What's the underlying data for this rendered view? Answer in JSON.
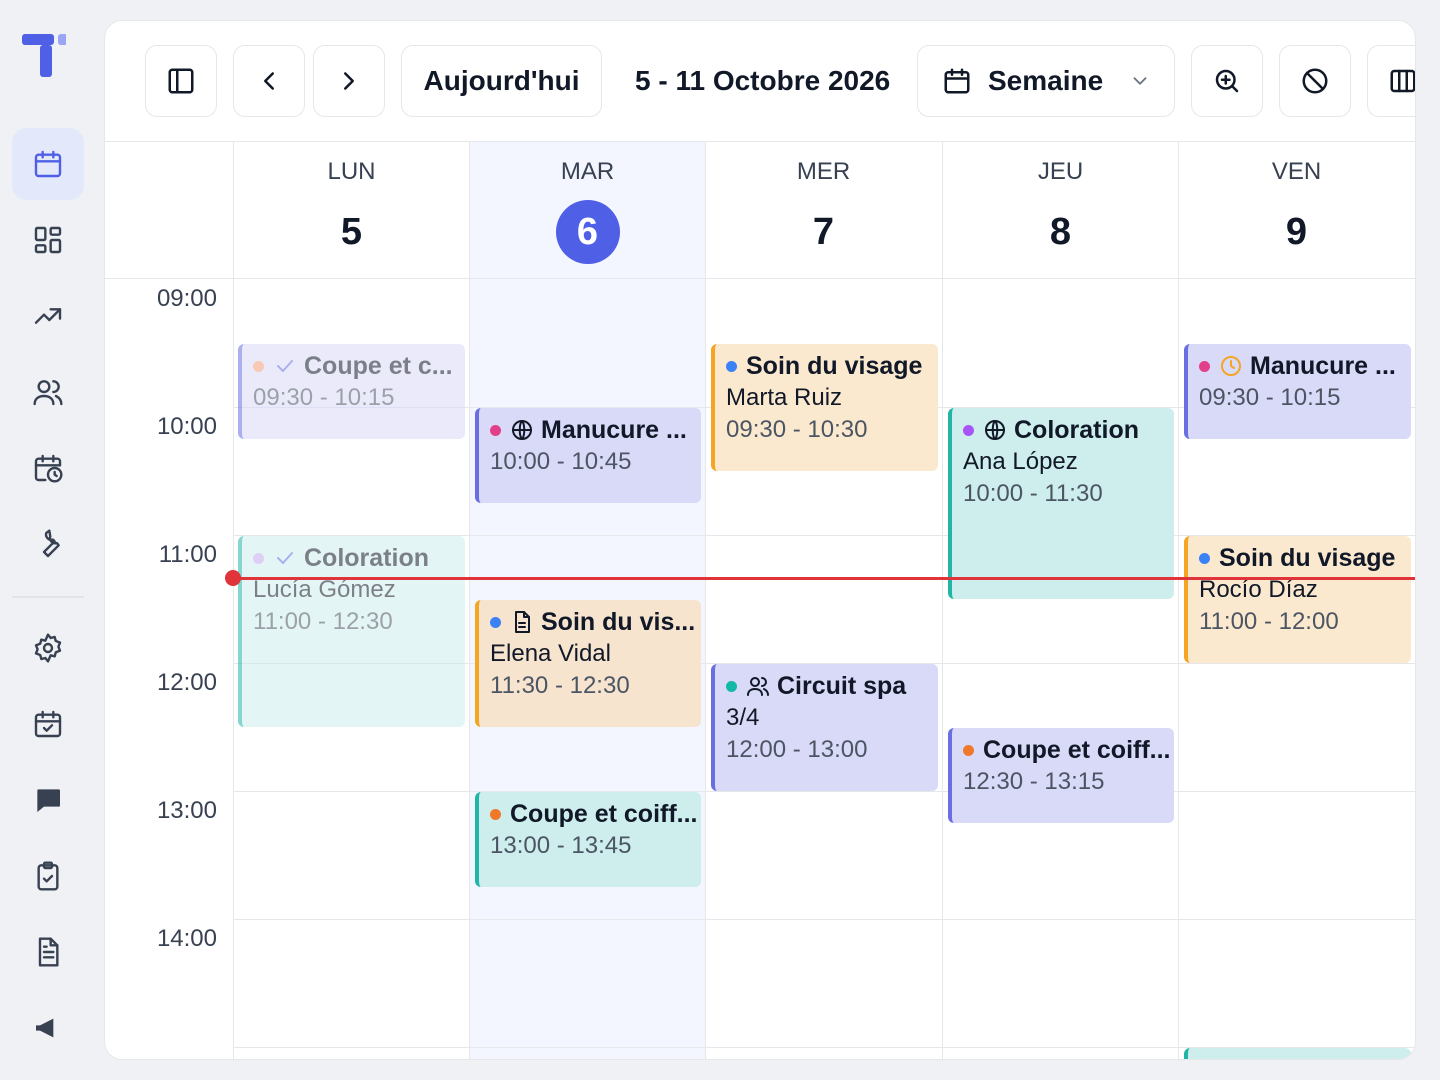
{
  "app": {
    "brand_colors": {
      "primary": "#4f5fe6",
      "now_line": "#e0343a"
    }
  },
  "rail": {
    "logo_icon": "t-logo-icon",
    "items": [
      "calendar-icon",
      "dashboard-icon",
      "trending-icon",
      "users-icon",
      "calendar-clock-icon",
      "wrench-icon",
      "settings-icon",
      "calendar-check-icon",
      "chat-icon",
      "clipboard-check-icon",
      "document-icon",
      "megaphone-icon"
    ],
    "active": "calendar-icon"
  },
  "toolbar": {
    "today_label": "Aujourd'hui",
    "date_range": "5 - 11 Octobre 2026",
    "view_label": "Semaine",
    "icons": [
      "sidebar-toggle-icon",
      "chevron-left-icon",
      "chevron-right-icon",
      "calendar-icon",
      "chevron-down-icon",
      "zoom-in-icon",
      "block-icon",
      "columns-icon"
    ]
  },
  "days": [
    {
      "dow": "LUN",
      "num": "5",
      "today": false
    },
    {
      "dow": "MAR",
      "num": "6",
      "today": true
    },
    {
      "dow": "MER",
      "num": "7",
      "today": false
    },
    {
      "dow": "JEU",
      "num": "8",
      "today": false
    },
    {
      "dow": "VEN",
      "num": "9",
      "today": false
    }
  ],
  "time_labels": [
    "09:00",
    "10:00",
    "11:00",
    "12:00",
    "13:00",
    "14:00"
  ],
  "events": [
    {
      "title": "Coupe et c...",
      "time": "09:30 - 10:15",
      "dot": "#f59e7a",
      "icon": "check-icon"
    },
    {
      "title": "Coloration",
      "client": "Lucía Gómez",
      "time": "11:00 - 12:30",
      "dot": "#c4a8ef",
      "icon": "check-icon"
    },
    {
      "title": "Manucure ...",
      "time": "10:00 - 10:45",
      "dot": "#e23f8a",
      "icon": "globe-icon"
    },
    {
      "title": "Soin du vis...",
      "client": "Elena Vidal",
      "time": "11:30 - 12:30",
      "dot": "#3b82f6",
      "icon": "document-icon"
    },
    {
      "title": "Coupe et coiff...",
      "time": "13:00 - 13:45",
      "dot": "#f0782a"
    },
    {
      "title": "Soin du visage",
      "client": "Marta Ruiz",
      "time": "09:30 - 10:30",
      "dot": "#3b82f6"
    },
    {
      "title": "Circuit spa",
      "client": "3/4",
      "time": "12:00 - 13:00",
      "dot": "#14b8a6",
      "icon": "users-icon"
    },
    {
      "title": "Coloration",
      "client": "Ana López",
      "time": "10:00 - 11:30",
      "dot": "#a855f7",
      "icon": "globe-icon"
    },
    {
      "title": "Coupe et coiff...",
      "time": "12:30 - 13:15",
      "dot": "#f0782a"
    },
    {
      "title": "Manucure ...",
      "time": "09:30 - 10:15",
      "dot": "#e23f8a",
      "icon": "clock-icon"
    },
    {
      "title": "Soin du visage",
      "client": "Rocío Díaz",
      "time": "11:00 - 12:00",
      "dot": "#3b82f6"
    }
  ]
}
